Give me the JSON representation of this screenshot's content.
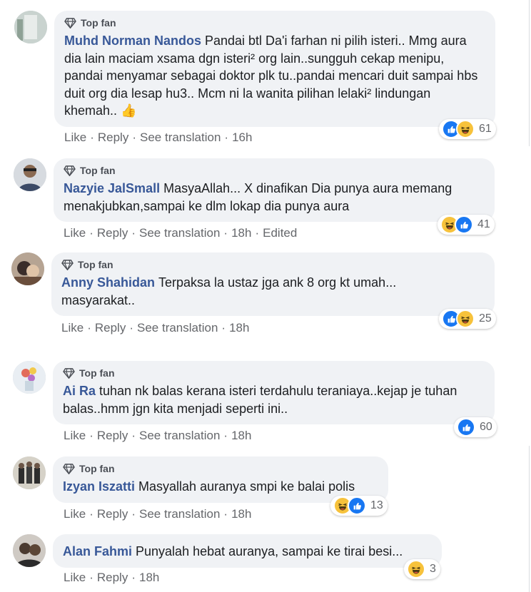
{
  "badge_label": "Top fan",
  "actions": {
    "like": "Like",
    "reply": "Reply",
    "translate": "See translation",
    "sep": "·"
  },
  "comments": [
    {
      "name": "Muhd Norman Nandos",
      "text": "Pandai btl Da'i farhan ni pilih isteri.. Mmg aura dia lain maciam xsama dgn isteri² org lain..sungguh cekap menipu, pandai menyamar sebagai doktor plk tu..pandai mencari duit sampai hbs duit org dia lesap hu3.. Mcm ni la wanita pilihan lelaki² lindungan khemah..",
      "emoji": "👍",
      "time": "16h",
      "edited": "",
      "reactions": [
        "like",
        "haha"
      ],
      "count": "61"
    },
    {
      "name": "Nazyie JalSmall",
      "text": "MasyaAllah... X dinafikan Dia punya aura memang menakjubkan,sampai ke dlm lokap dia punya aura",
      "time": "18h",
      "edited": "Edited",
      "reactions": [
        "haha",
        "like"
      ],
      "count": "41"
    },
    {
      "name": "Anny Shahidan",
      "text": "Terpaksa la ustaz jga ank 8 org kt umah... masyarakat..",
      "time": "18h",
      "reactions": [
        "like",
        "haha"
      ],
      "count": "25"
    },
    {
      "name": "Ai Ra",
      "text": "tuhan nk balas kerana isteri terdahulu teraniaya..kejap je tuhan balas..hmm jgn kita menjadi seperti ini..",
      "time": "18h",
      "reactions": [
        "like"
      ],
      "count": "60"
    },
    {
      "name": "Izyan Iszatti",
      "text": "Masyallah auranya smpi ke balai polis",
      "time": "18h",
      "reactions": [
        "haha",
        "like"
      ],
      "count": "13"
    },
    {
      "name": "Alan Fahmi",
      "text": "Punyalah hebat auranya, sampai ke tirai besi...",
      "time": "18h",
      "reactions": [
        "haha"
      ],
      "count": "3"
    }
  ],
  "colors": {
    "name": "#385898",
    "meta": "#65676b",
    "bubble": "#f0f2f5",
    "like": "#1877f2",
    "haha": "#f7c23b"
  }
}
